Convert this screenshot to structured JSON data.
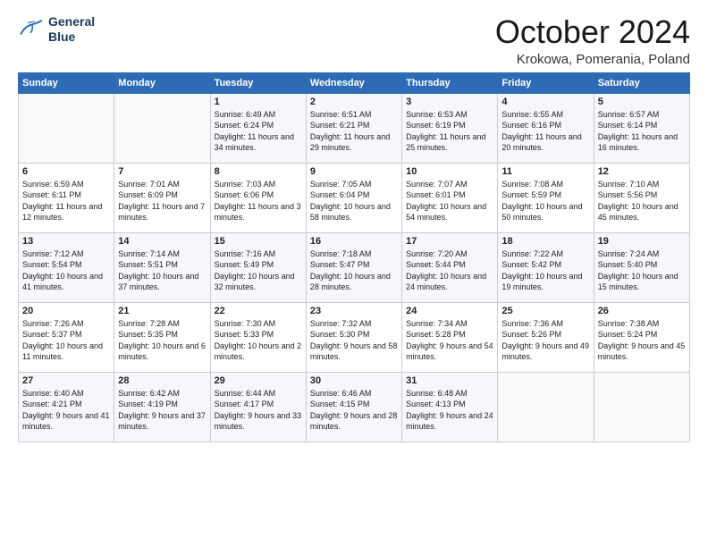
{
  "logo": {
    "line1": "General",
    "line2": "Blue"
  },
  "title": "October 2024",
  "subtitle": "Krokowa, Pomerania, Poland",
  "weekdays": [
    "Sunday",
    "Monday",
    "Tuesday",
    "Wednesday",
    "Thursday",
    "Friday",
    "Saturday"
  ],
  "weeks": [
    [
      {
        "day": "",
        "sunrise": "",
        "sunset": "",
        "daylight": ""
      },
      {
        "day": "",
        "sunrise": "",
        "sunset": "",
        "daylight": ""
      },
      {
        "day": "1",
        "sunrise": "Sunrise: 6:49 AM",
        "sunset": "Sunset: 6:24 PM",
        "daylight": "Daylight: 11 hours and 34 minutes."
      },
      {
        "day": "2",
        "sunrise": "Sunrise: 6:51 AM",
        "sunset": "Sunset: 6:21 PM",
        "daylight": "Daylight: 11 hours and 29 minutes."
      },
      {
        "day": "3",
        "sunrise": "Sunrise: 6:53 AM",
        "sunset": "Sunset: 6:19 PM",
        "daylight": "Daylight: 11 hours and 25 minutes."
      },
      {
        "day": "4",
        "sunrise": "Sunrise: 6:55 AM",
        "sunset": "Sunset: 6:16 PM",
        "daylight": "Daylight: 11 hours and 20 minutes."
      },
      {
        "day": "5",
        "sunrise": "Sunrise: 6:57 AM",
        "sunset": "Sunset: 6:14 PM",
        "daylight": "Daylight: 11 hours and 16 minutes."
      }
    ],
    [
      {
        "day": "6",
        "sunrise": "Sunrise: 6:59 AM",
        "sunset": "Sunset: 6:11 PM",
        "daylight": "Daylight: 11 hours and 12 minutes."
      },
      {
        "day": "7",
        "sunrise": "Sunrise: 7:01 AM",
        "sunset": "Sunset: 6:09 PM",
        "daylight": "Daylight: 11 hours and 7 minutes."
      },
      {
        "day": "8",
        "sunrise": "Sunrise: 7:03 AM",
        "sunset": "Sunset: 6:06 PM",
        "daylight": "Daylight: 11 hours and 3 minutes."
      },
      {
        "day": "9",
        "sunrise": "Sunrise: 7:05 AM",
        "sunset": "Sunset: 6:04 PM",
        "daylight": "Daylight: 10 hours and 58 minutes."
      },
      {
        "day": "10",
        "sunrise": "Sunrise: 7:07 AM",
        "sunset": "Sunset: 6:01 PM",
        "daylight": "Daylight: 10 hours and 54 minutes."
      },
      {
        "day": "11",
        "sunrise": "Sunrise: 7:08 AM",
        "sunset": "Sunset: 5:59 PM",
        "daylight": "Daylight: 10 hours and 50 minutes."
      },
      {
        "day": "12",
        "sunrise": "Sunrise: 7:10 AM",
        "sunset": "Sunset: 5:56 PM",
        "daylight": "Daylight: 10 hours and 45 minutes."
      }
    ],
    [
      {
        "day": "13",
        "sunrise": "Sunrise: 7:12 AM",
        "sunset": "Sunset: 5:54 PM",
        "daylight": "Daylight: 10 hours and 41 minutes."
      },
      {
        "day": "14",
        "sunrise": "Sunrise: 7:14 AM",
        "sunset": "Sunset: 5:51 PM",
        "daylight": "Daylight: 10 hours and 37 minutes."
      },
      {
        "day": "15",
        "sunrise": "Sunrise: 7:16 AM",
        "sunset": "Sunset: 5:49 PM",
        "daylight": "Daylight: 10 hours and 32 minutes."
      },
      {
        "day": "16",
        "sunrise": "Sunrise: 7:18 AM",
        "sunset": "Sunset: 5:47 PM",
        "daylight": "Daylight: 10 hours and 28 minutes."
      },
      {
        "day": "17",
        "sunrise": "Sunrise: 7:20 AM",
        "sunset": "Sunset: 5:44 PM",
        "daylight": "Daylight: 10 hours and 24 minutes."
      },
      {
        "day": "18",
        "sunrise": "Sunrise: 7:22 AM",
        "sunset": "Sunset: 5:42 PM",
        "daylight": "Daylight: 10 hours and 19 minutes."
      },
      {
        "day": "19",
        "sunrise": "Sunrise: 7:24 AM",
        "sunset": "Sunset: 5:40 PM",
        "daylight": "Daylight: 10 hours and 15 minutes."
      }
    ],
    [
      {
        "day": "20",
        "sunrise": "Sunrise: 7:26 AM",
        "sunset": "Sunset: 5:37 PM",
        "daylight": "Daylight: 10 hours and 11 minutes."
      },
      {
        "day": "21",
        "sunrise": "Sunrise: 7:28 AM",
        "sunset": "Sunset: 5:35 PM",
        "daylight": "Daylight: 10 hours and 6 minutes."
      },
      {
        "day": "22",
        "sunrise": "Sunrise: 7:30 AM",
        "sunset": "Sunset: 5:33 PM",
        "daylight": "Daylight: 10 hours and 2 minutes."
      },
      {
        "day": "23",
        "sunrise": "Sunrise: 7:32 AM",
        "sunset": "Sunset: 5:30 PM",
        "daylight": "Daylight: 9 hours and 58 minutes."
      },
      {
        "day": "24",
        "sunrise": "Sunrise: 7:34 AM",
        "sunset": "Sunset: 5:28 PM",
        "daylight": "Daylight: 9 hours and 54 minutes."
      },
      {
        "day": "25",
        "sunrise": "Sunrise: 7:36 AM",
        "sunset": "Sunset: 5:26 PM",
        "daylight": "Daylight: 9 hours and 49 minutes."
      },
      {
        "day": "26",
        "sunrise": "Sunrise: 7:38 AM",
        "sunset": "Sunset: 5:24 PM",
        "daylight": "Daylight: 9 hours and 45 minutes."
      }
    ],
    [
      {
        "day": "27",
        "sunrise": "Sunrise: 6:40 AM",
        "sunset": "Sunset: 4:21 PM",
        "daylight": "Daylight: 9 hours and 41 minutes."
      },
      {
        "day": "28",
        "sunrise": "Sunrise: 6:42 AM",
        "sunset": "Sunset: 4:19 PM",
        "daylight": "Daylight: 9 hours and 37 minutes."
      },
      {
        "day": "29",
        "sunrise": "Sunrise: 6:44 AM",
        "sunset": "Sunset: 4:17 PM",
        "daylight": "Daylight: 9 hours and 33 minutes."
      },
      {
        "day": "30",
        "sunrise": "Sunrise: 6:46 AM",
        "sunset": "Sunset: 4:15 PM",
        "daylight": "Daylight: 9 hours and 28 minutes."
      },
      {
        "day": "31",
        "sunrise": "Sunrise: 6:48 AM",
        "sunset": "Sunset: 4:13 PM",
        "daylight": "Daylight: 9 hours and 24 minutes."
      },
      {
        "day": "",
        "sunrise": "",
        "sunset": "",
        "daylight": ""
      },
      {
        "day": "",
        "sunrise": "",
        "sunset": "",
        "daylight": ""
      }
    ]
  ]
}
